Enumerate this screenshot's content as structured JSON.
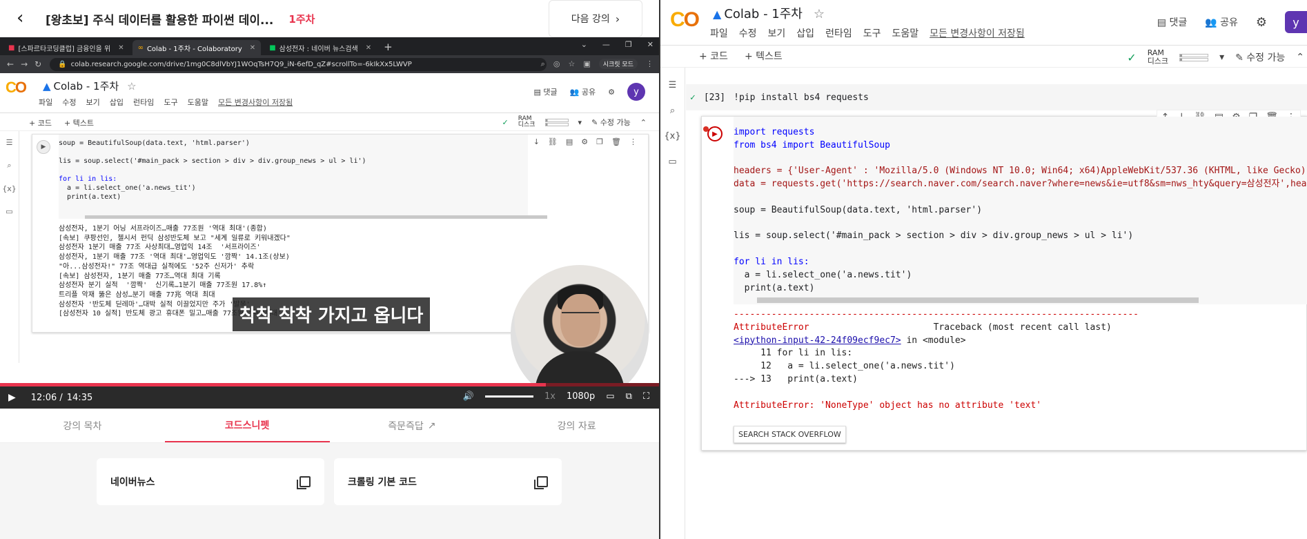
{
  "lecture": {
    "title": "[왕초보] 주식 데이터를 활용한 파이썬 데이...",
    "week": "1주차",
    "next_label": "다음 강의",
    "tabs": [
      {
        "label": "강의 목차"
      },
      {
        "label": "코드스니펫"
      },
      {
        "label": "즉문즉답"
      },
      {
        "label": "강의 자료"
      }
    ],
    "snippets": [
      {
        "label": "네이버뉴스"
      },
      {
        "label": "크롤링 기본 코드"
      }
    ]
  },
  "browser": {
    "tabs": [
      {
        "label": "[스파르타코딩클럽] 금융인을 위"
      },
      {
        "label": "Colab - 1주차 - Colaboratory"
      },
      {
        "label": "삼성전자 : 네이버 뉴스검색"
      }
    ],
    "url": "colab.research.google.com/drive/1mg0C8dlVbYJ1WOqTsH7Q9_iN-6efD_qZ#scrollTo=-6kIkXx5LWVP",
    "incognito_label": "시크릿 모드"
  },
  "colab": {
    "title": "Colab - 1주차",
    "menu": [
      "파일",
      "수정",
      "보기",
      "삽입",
      "런타임",
      "도구",
      "도움말"
    ],
    "saved_label": "모든 변경사항이 저장됨",
    "comment_label": "댓글",
    "share_label": "공유",
    "avatar_letter": "y",
    "add_code": "+ 코드",
    "add_text": "+ 텍스트",
    "ram_label": "RAM",
    "disk_label": "디스크",
    "edit_label": "수정 가능"
  },
  "inner_cell": {
    "code_lines": [
      "soup = BeautifulSoup(data.text, 'html.parser')",
      "",
      "lis = soup.select('#main_pack > section > div > div.group_news > ul > li')",
      "",
      "for li in lis:",
      "  a = li.select_one('a.news_tit')",
      "  print(a.text)"
    ],
    "output_lines": [
      "삼성전자, 1분기 어닝 서프라이즈…매출 77조원 '역대 최대'(종합)",
      "[속보] 쿠팡선인, 첼시서 펀딕 삼성반도체 보고 \"세계 일류로 키워내겠다\"",
      "삼성전자 1분기 매출 77조 사상최대…영업익 14조  '서프라이즈'",
      "삼성전자, 1분기 매출 77조 '역대 최대'…영업익도 '깜짝' 14.1조(상보)",
      "\"아...삼성전자!\" 77조 역대급 실적에도 '52주 신저가' 추락",
      "[속보] 삼성전자, 1분기 매출 77조…역대 최대 기록",
      "삼성전자 분기 실적  '깜짝'  신기록…1분기 매출 77조원 17.8%↑",
      "트리플 악재 뚫은 삼성…분기 매출 77兆 역대 최대",
      "삼성전자 '반도체 딛레마'…대박 실적 이끌었지만 주가 '발목'",
      "[삼성전자 10 실적] 반도체 광고 휴대폰 밀고…매출 77조원 '사상최대'"
    ]
  },
  "video": {
    "subtitle": "착착 착착 가지고 옵니다",
    "current_time": "12:06 /",
    "duration": "14:35",
    "progress_fraction": 0.8286,
    "speed": "1x",
    "quality": "1080p"
  },
  "right_cell1": {
    "exec_count": "[23]",
    "code": "!pip install bs4 requests"
  },
  "right_cell2": {
    "code_lines": [
      "import requests",
      "from bs4 import BeautifulSoup",
      "",
      "headers = {'User-Agent' : 'Mozilla/5.0 (Windows NT 10.0; Win64; x64)AppleWebKit/537.36 (KHTML, like Gecko) Chrome/73.0",
      "data = requests.get('https://search.naver.com/search.naver?where=news&ie=utf8&sm=nws_hty&query=삼성전자',headers=heade",
      "",
      "soup = BeautifulSoup(data.text, 'html.parser')",
      "",
      "lis = soup.select('#main_pack > section > div > div.group_news > ul > li')",
      "",
      "for li in lis:",
      "  a = li.select_one('a.news.tit')",
      "  print(a.text)"
    ],
    "divider_line": "---------------------------------------------------------------------------",
    "error_name": "AttributeError",
    "traceback_label": "Traceback (most recent call last)",
    "input_link": "<ipython-input-42-24f09ecf9ec7>",
    "in_module": " in <module>",
    "tb_line11": "     11 for li in lis:",
    "tb_line12": "     12   a = li.select_one('a.news.tit')",
    "tb_line13": "---> 13   print(a.text)",
    "error_message": "AttributeError: 'NoneType' object has no attribute 'text'",
    "stack_overflow_label": "SEARCH STACK OVERFLOW"
  },
  "colors": {
    "accent": "#e8344e",
    "colab_yellow": "#f9ab00",
    "colab_orange": "#e8710a",
    "error_red": "#c00000"
  }
}
